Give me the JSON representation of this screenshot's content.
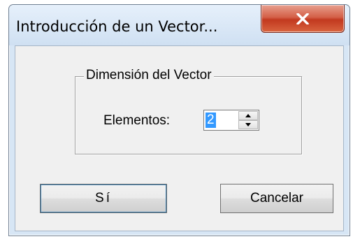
{
  "window": {
    "title": "Introducción de un Vector..."
  },
  "group": {
    "legend": "Dimensión del Vector",
    "field_label": "Elementos:",
    "field_value": "2"
  },
  "buttons": {
    "yes": "Sí",
    "cancel": "Cancelar"
  },
  "icons": {
    "close": "close-icon",
    "spin_up": "spin-up-icon",
    "spin_down": "spin-down-icon"
  },
  "colors": {
    "selection": "#3399ff",
    "close_button": "#c2391f",
    "title_bar": "#d7e6f5"
  }
}
